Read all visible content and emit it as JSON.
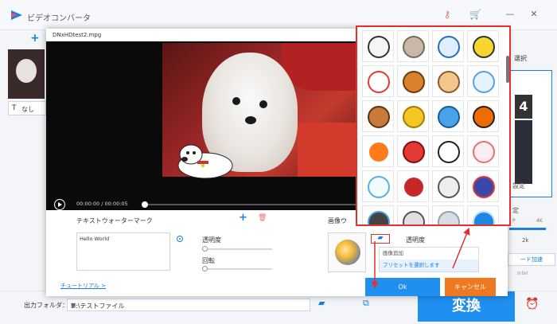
{
  "app": {
    "title": "ビデオコンバータ",
    "add_symbol": "+",
    "subtitle_icon": "T",
    "subtitle_value": "なし",
    "accent": "#1a7fe0"
  },
  "titlebar": {
    "icons": [
      "key-icon",
      "cart-icon"
    ],
    "window_controls": [
      "minimize",
      "close"
    ]
  },
  "right_panel": {
    "select_label": "選択",
    "badge_4": "4",
    "settings_label": "設定",
    "quality_label": "定",
    "slider_left": "P",
    "slider_right": "4K",
    "slider_value": "2k",
    "hw_accel_label": "ード加速",
    "intel_label": "Intel"
  },
  "bottom_bar": {
    "output_label": "出力フォルダ：",
    "output_path": "D:\\テストファイル",
    "convert_label": "変換"
  },
  "dialog": {
    "title": "DNxHDtest2.mpg",
    "time_display": "00:00:00 / 00:00:05",
    "text_watermark_header": "テキストウォーターマーク",
    "text_value": "Hello World",
    "opacity_label": "透明度",
    "rotation_label": "回転",
    "tutorial_link": "チュートリアル >",
    "image_watermark_header": "画像ウ",
    "image_opacity_label": "透明度",
    "menu_add_image": "画像追加",
    "menu_select_preset": "プリセットを選択します",
    "ok_label": "Ok",
    "cancel_label": "キャンセル",
    "ok_color": "#1f8ff0",
    "cancel_color": "#f07820"
  },
  "sticker_panel": {
    "highlight_color": "#e03030",
    "stickers": [
      "tiger-sticker",
      "sheep-sticker",
      "ghost-sticker",
      "homer-sticker",
      "kitty-sticker",
      "beaver-sticker",
      "cat-sticker",
      "bunny-sticker",
      "bear-sticker",
      "puffer-sticker",
      "smiley-sticker",
      "bomb-sticker",
      "fish-sticker",
      "apple-sticker",
      "dog-sticker",
      "blush-sticker",
      "bubble-sticker",
      "decepticon-sticker",
      "toon-sticker",
      "robot-sticker",
      "monitor-sticker",
      "laptop-sticker",
      "cd-sticker",
      "screen-sticker"
    ]
  }
}
